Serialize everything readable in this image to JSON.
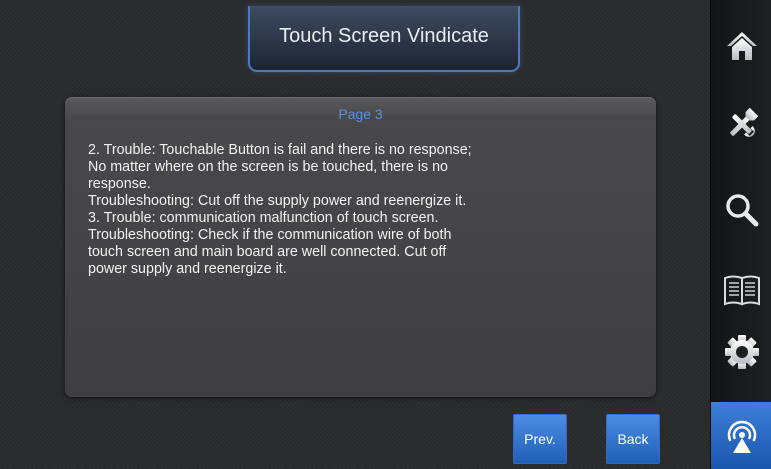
{
  "header": {
    "title": "Touch Screen Vindicate"
  },
  "content": {
    "page_label": "Page 3",
    "lines": [
      "2. Trouble: Touchable Button is fail and there is no response;",
      "No matter where on the screen is be touched, there is no",
      "response.",
      "Troubleshooting: Cut off the supply power and reenergize it.",
      "3. Trouble: communication malfunction of touch screen.",
      "Troubleshooting:  Check if the communication wire of both",
      "touch screen and main board are well connected. Cut off",
      "power supply and reenergize it."
    ]
  },
  "buttons": {
    "prev_label": "Prev.",
    "back_label": "Back"
  },
  "sidebar": {
    "items": [
      {
        "icon": "home-icon"
      },
      {
        "icon": "tools-icon"
      },
      {
        "icon": "search-icon"
      },
      {
        "icon": "manual-book-icon"
      },
      {
        "icon": "gear-icon"
      },
      {
        "icon": "signal-icon",
        "active": true
      }
    ]
  },
  "colors": {
    "accent_blue": "#3d7fd9",
    "page_label": "#5a8fe0",
    "background": "#2a2b2c"
  }
}
